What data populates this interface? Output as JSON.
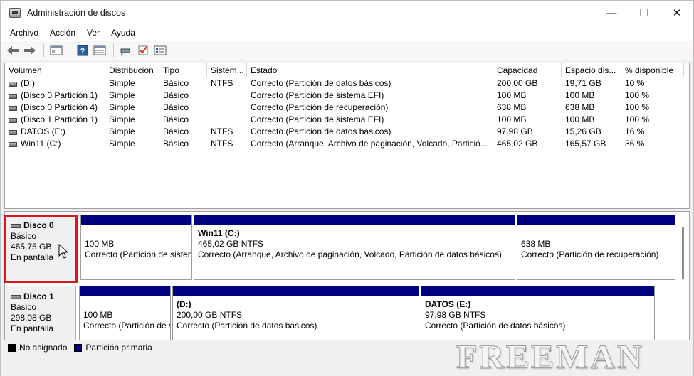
{
  "window": {
    "title": "Administración de discos",
    "controls": {
      "minimize": "—",
      "maximize": "☐",
      "close": "✕"
    }
  },
  "menu": [
    "Archivo",
    "Acción",
    "Ver",
    "Ayuda"
  ],
  "toolbar": {
    "icons": [
      "back-arrow-icon",
      "forward-arrow-icon",
      "properties-icon",
      "help-icon",
      "show-hide-icon",
      "connect-icon",
      "check-icon",
      "list-icon"
    ]
  },
  "volumes": {
    "columns": [
      "Volumen",
      "Distribución",
      "Tipo",
      "Sistem...",
      "Estado",
      "Capacidad",
      "Espacio dis...",
      "% disponible"
    ],
    "rows": [
      [
        "(D:)",
        "Simple",
        "Básico",
        "NTFS",
        "Correcto (Partición de datos básicos)",
        "200,00 GB",
        "19,71 GB",
        "10 %"
      ],
      [
        "(Disco 0 Partición 1)",
        "Simple",
        "Básico",
        "",
        "Correcto (Partición de sistema EFI)",
        "100 MB",
        "100 MB",
        "100 %"
      ],
      [
        "(Disco 0 Partición 4)",
        "Simple",
        "Básico",
        "",
        "Correcto (Partición de recuperación)",
        "638 MB",
        "638 MB",
        "100 %"
      ],
      [
        "(Disco 1 Partición 1)",
        "Simple",
        "Básico",
        "",
        "Correcto (Partición de sistema EFI)",
        "100 MB",
        "100 MB",
        "100 %"
      ],
      [
        "DATOS (E:)",
        "Simple",
        "Básico",
        "NTFS",
        "Correcto (Partición de datos básicos)",
        "97,98 GB",
        "15,26 GB",
        "16 %"
      ],
      [
        "Win11 (C:)",
        "Simple",
        "Básico",
        "NTFS",
        "Correcto (Arranque, Archivo de paginación, Volcado, Partició...",
        "465,02 GB",
        "165,57 GB",
        "36 %"
      ]
    ]
  },
  "disks": [
    {
      "name": "Disco 0",
      "type": "Básico",
      "size": "465,75 GB",
      "status": "En pantalla",
      "partitions": [
        {
          "name": "",
          "size": "100 MB",
          "status": "Correcto (Partición de sistema EFI)"
        },
        {
          "name": "Win11  (C:)",
          "size": "465,02 GB NTFS",
          "status": "Correcto (Arranque, Archivo de paginación, Volcado, Partición de datos básicos)"
        },
        {
          "name": "",
          "size": "638 MB",
          "status": "Correcto (Partición de recuperación)"
        }
      ]
    },
    {
      "name": "Disco 1",
      "type": "Básico",
      "size": "298,08 GB",
      "status": "En pantalla",
      "partitions": [
        {
          "name": "",
          "size": "100 MB",
          "status": "Correcto (Partición de sistema EFI)"
        },
        {
          "name": " (D:)",
          "size": "200,00 GB NTFS",
          "status": "Correcto (Partición de datos básicos)"
        },
        {
          "name": "DATOS  (E:)",
          "size": "97,98 GB NTFS",
          "status": "Correcto (Partición de datos básicos)"
        }
      ]
    }
  ],
  "legend": [
    {
      "label": "No asignado",
      "color": "#000000"
    },
    {
      "label": "Partición primaria",
      "color": "#000080"
    }
  ],
  "watermark": "FREEMAN"
}
